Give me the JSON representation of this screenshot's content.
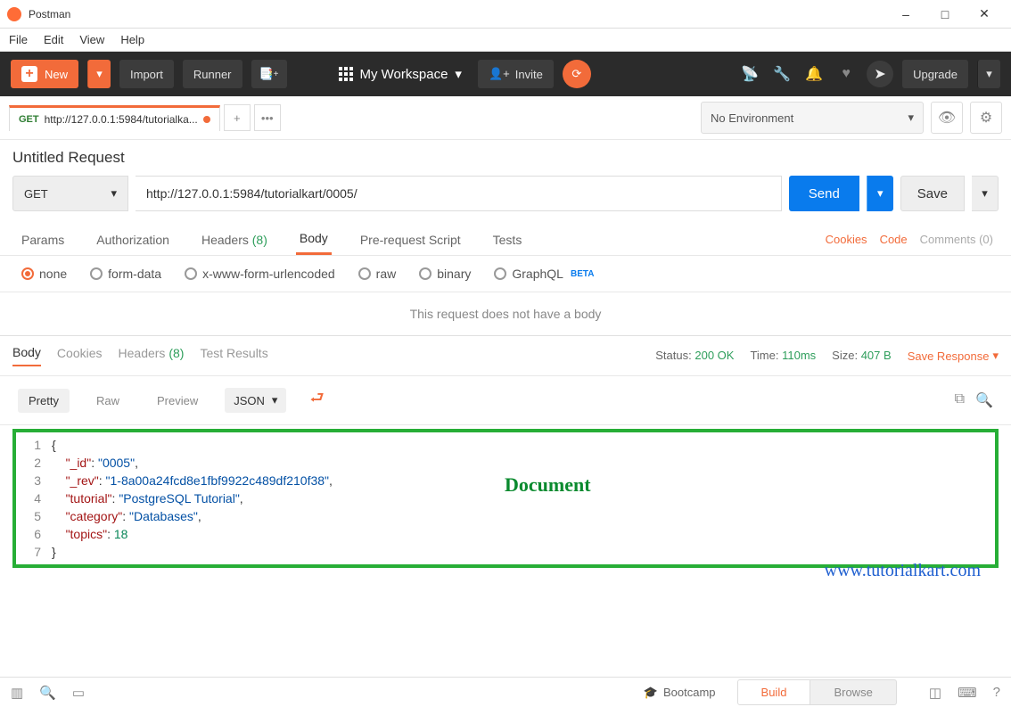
{
  "window": {
    "title": "Postman"
  },
  "menu": {
    "file": "File",
    "edit": "Edit",
    "view": "View",
    "help": "Help"
  },
  "toolbar": {
    "new": "New",
    "import": "Import",
    "runner": "Runner",
    "workspace": "My Workspace",
    "invite": "Invite",
    "upgrade": "Upgrade"
  },
  "tab": {
    "method": "GET",
    "label": "http://127.0.0.1:5984/tutorialka..."
  },
  "env": {
    "selected": "No Environment"
  },
  "request": {
    "name": "Untitled Request",
    "method": "GET",
    "url": "http://127.0.0.1:5984/tutorialkart/0005/",
    "send": "Send",
    "save": "Save"
  },
  "reqtabs": {
    "params": "Params",
    "auth": "Authorization",
    "headers": "Headers",
    "headers_count": "(8)",
    "body": "Body",
    "prereq": "Pre-request Script",
    "tests": "Tests",
    "cookies": "Cookies",
    "code": "Code",
    "comments": "Comments (0)"
  },
  "bodytypes": {
    "none": "none",
    "formdata": "form-data",
    "urlen": "x-www-form-urlencoded",
    "raw": "raw",
    "binary": "binary",
    "graphql": "GraphQL",
    "beta": "BETA"
  },
  "nobody": "This request does not have a body",
  "resp": {
    "body": "Body",
    "cookies": "Cookies",
    "headers": "Headers",
    "headers_count": "(8)",
    "tests": "Test Results",
    "status_lbl": "Status:",
    "status_val": "200 OK",
    "time_lbl": "Time:",
    "time_val": "110ms",
    "size_lbl": "Size:",
    "size_val": "407 B",
    "save": "Save Response"
  },
  "viewer": {
    "pretty": "Pretty",
    "raw": "Raw",
    "preview": "Preview",
    "format": "JSON"
  },
  "code": {
    "l1": "{",
    "l2k": "\"_id\"",
    "l2v": "\"0005\"",
    "l3k": "\"_rev\"",
    "l3v": "\"1-8a00a24fcd8e1fbf9922c489df210f38\"",
    "l4k": "\"tutorial\"",
    "l4v": "\"PostgreSQL Tutorial\"",
    "l5k": "\"category\"",
    "l5v": "\"Databases\"",
    "l6k": "\"topics\"",
    "l6v": "18",
    "l7": "}"
  },
  "annot": {
    "doc": "Document",
    "watermark": "www.tutorialkart.com"
  },
  "footer": {
    "bootcamp": "Bootcamp",
    "build": "Build",
    "browse": "Browse"
  }
}
